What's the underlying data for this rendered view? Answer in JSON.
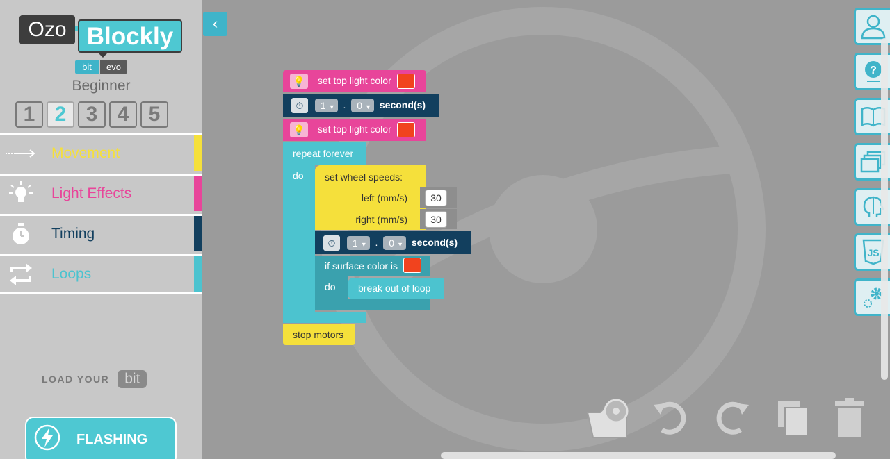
{
  "logo": {
    "ozo": "Ozo",
    "blockly": "Blockly"
  },
  "brand": {
    "bit": "bit",
    "evo": "evo"
  },
  "level": {
    "name": "Beginner",
    "steps": [
      "1",
      "2",
      "3",
      "4",
      "5"
    ],
    "active": "2"
  },
  "categories": [
    {
      "label": "Movement",
      "color": "#f5e03b"
    },
    {
      "label": "Light Effects",
      "color": "#e8459a"
    },
    {
      "label": "Timing",
      "color": "#123f5e"
    },
    {
      "label": "Loops",
      "color": "#4cc3cf"
    }
  ],
  "load": {
    "text": "LOAD YOUR",
    "badge": "bit"
  },
  "flash": {
    "label": "FLASHING"
  },
  "workspace": {
    "collapse_icon": "chevron-left-icon",
    "blocks": {
      "set_top_light_1": "set top light color",
      "wait_1": {
        "a": "1",
        "b": "0",
        "sep": ".",
        "unit": "second(s)"
      },
      "set_top_light_2": "set top light color",
      "repeat": "repeat forever",
      "do": "do",
      "wheel": {
        "title": "set wheel speeds:",
        "left_label": "left (mm/s)",
        "left_value": "30",
        "right_label": "right (mm/s)",
        "right_value": "30"
      },
      "wait_2": {
        "a": "1",
        "b": "0",
        "sep": ".",
        "unit": "second(s)"
      },
      "if_surface": "if surface color is",
      "do2": "do",
      "break": "break out of loop",
      "stop": "stop motors"
    },
    "light_color": "#f1431e"
  },
  "toolbar_icons": [
    "user-icon",
    "help-icon",
    "book-icon",
    "windows-icon",
    "brain-icon",
    "javascript-icon",
    "settings-icon"
  ],
  "bottom_icons": [
    "open-file-icon",
    "undo-icon",
    "redo-icon",
    "copy-icon",
    "trash-icon"
  ]
}
